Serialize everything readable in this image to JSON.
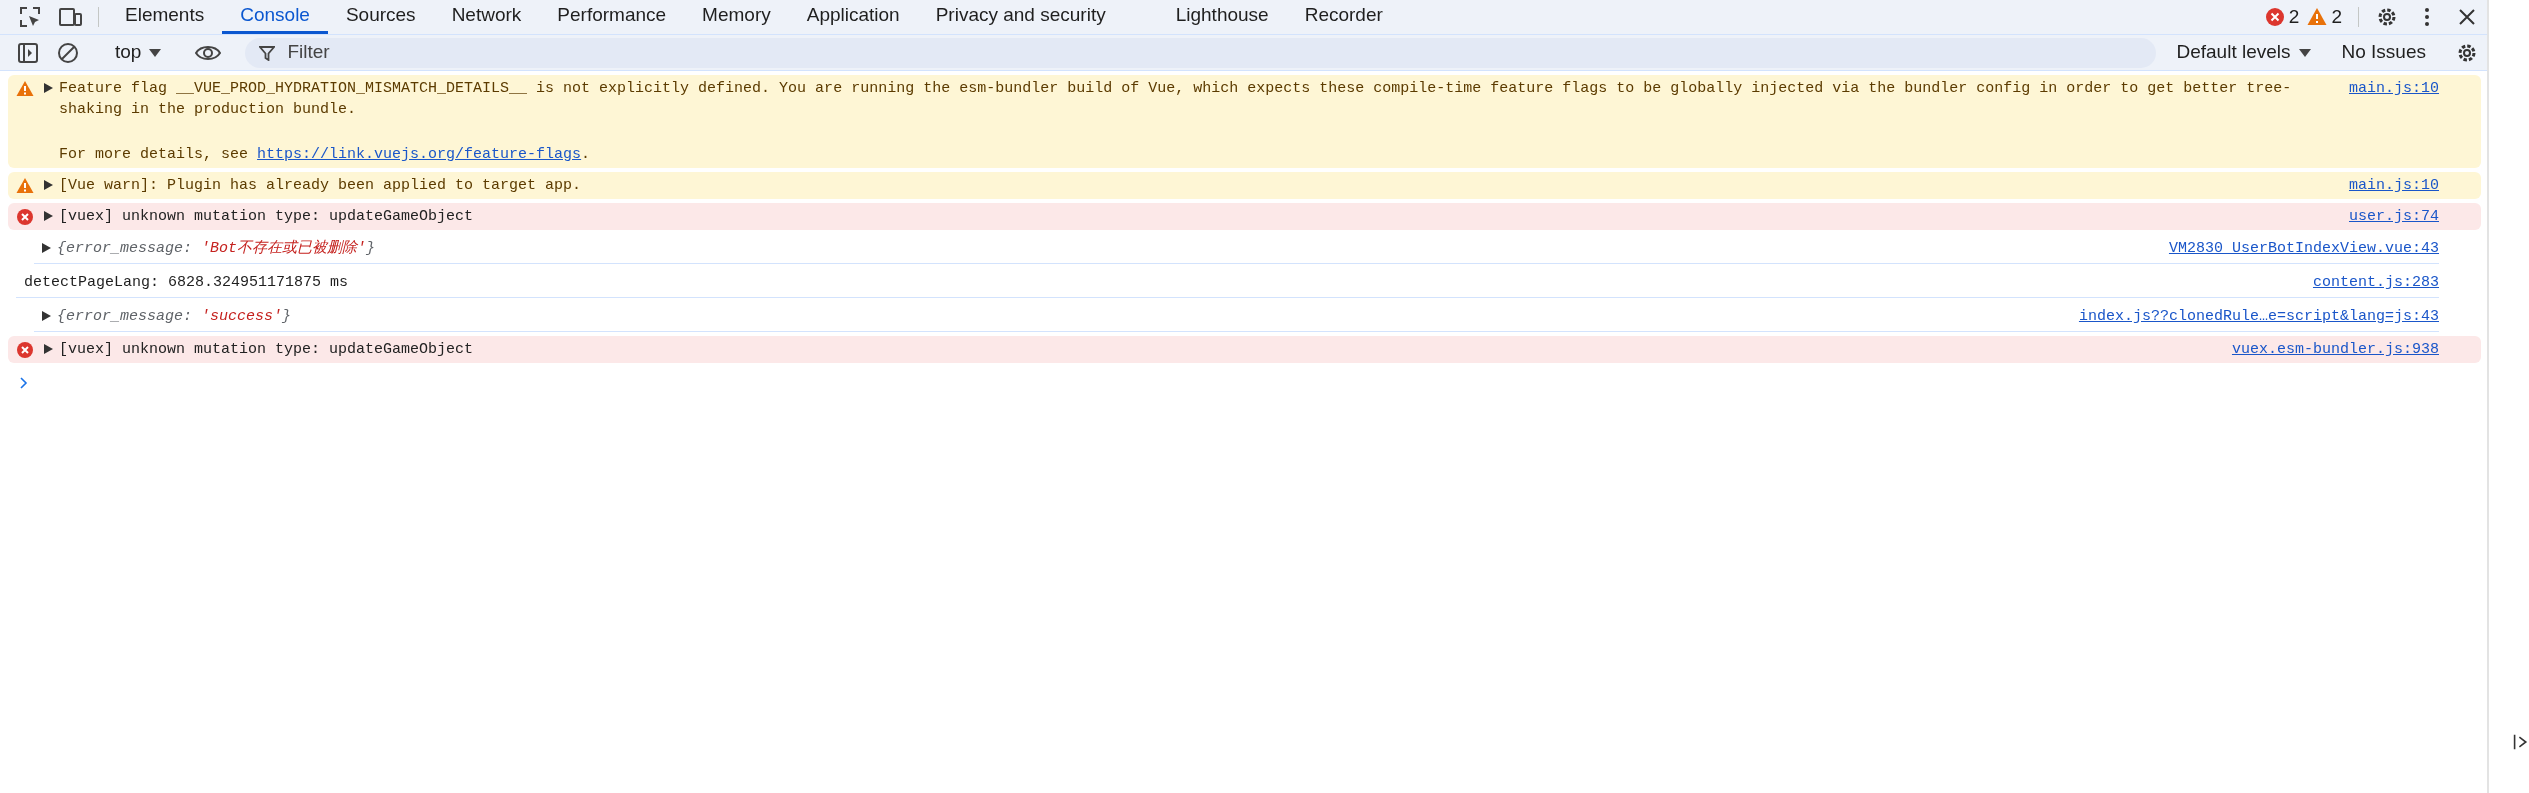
{
  "tabs": [
    {
      "label": "Elements",
      "selected": false
    },
    {
      "label": "Console",
      "selected": true
    },
    {
      "label": "Sources",
      "selected": false
    },
    {
      "label": "Network",
      "selected": false
    },
    {
      "label": "Performance",
      "selected": false
    },
    {
      "label": "Memory",
      "selected": false
    },
    {
      "label": "Application",
      "selected": false
    },
    {
      "label": "Privacy and security",
      "selected": false
    },
    {
      "label": "Lighthouse",
      "selected": false
    },
    {
      "label": "Recorder",
      "selected": false
    }
  ],
  "counts": {
    "errors": "2",
    "warnings": "2"
  },
  "toolbar": {
    "context": "top",
    "filter_placeholder": "Filter",
    "levels": "Default levels",
    "issues": "No Issues"
  },
  "messages": [
    {
      "kind": "warning",
      "expanded": false,
      "text": "Feature flag __VUE_PROD_HYDRATION_MISMATCH_DETAILS__ is not explicitly defined. You are running the esm-bundler build of Vue, which expects these compile-time feature flags to be globally injected via the bundler config in order to get better tree-shaking in the production bundle.",
      "details": {
        "text": "For more details, see ",
        "link": "https://link.vuejs.org/feature-flags",
        "end": "."
      },
      "source": "main.js:10"
    },
    {
      "kind": "warning",
      "expanded": false,
      "text": "[Vue warn]: Plugin has already been applied to target app.",
      "source": "main.js:10"
    },
    {
      "kind": "error",
      "expanded": false,
      "text": "[vuex] unknown mutation type: updateGameObject",
      "source": "user.js:74"
    },
    {
      "kind": "object",
      "expanded": false,
      "prefix": "{error_message: ",
      "value": "'Bot不存在或已被删除'",
      "suffix": "}",
      "source": "VM2830 UserBotIndexView.vue:43"
    },
    {
      "kind": "log",
      "text": "detectPageLang: 6828.324951171875 ms",
      "source": "content.js:283"
    },
    {
      "kind": "object",
      "expanded": false,
      "prefix": "{error_message: ",
      "value": "'success'",
      "suffix": "}",
      "source": "index.js??clonedRule…e=script&lang=js:43"
    },
    {
      "kind": "error",
      "expanded": false,
      "text": "[vuex] unknown mutation type: updateGameObject",
      "source": "vuex.esm-bundler.js:938"
    }
  ]
}
